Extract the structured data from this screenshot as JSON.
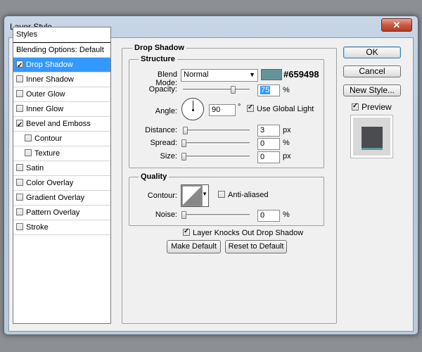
{
  "window": {
    "title": "Layer Style",
    "close_glyph": "✕"
  },
  "styles_panel": {
    "header": "Styles",
    "blending": "Blending Options: Default",
    "items": [
      {
        "label": "Drop Shadow",
        "checked": true,
        "selected": true,
        "indent": false
      },
      {
        "label": "Inner Shadow",
        "checked": false,
        "selected": false,
        "indent": false
      },
      {
        "label": "Outer Glow",
        "checked": false,
        "selected": false,
        "indent": false
      },
      {
        "label": "Inner Glow",
        "checked": false,
        "selected": false,
        "indent": false
      },
      {
        "label": "Bevel and Emboss",
        "checked": true,
        "selected": false,
        "indent": false
      },
      {
        "label": "Contour",
        "checked": false,
        "selected": false,
        "indent": true
      },
      {
        "label": "Texture",
        "checked": false,
        "selected": false,
        "indent": true
      },
      {
        "label": "Satin",
        "checked": false,
        "selected": false,
        "indent": false
      },
      {
        "label": "Color Overlay",
        "checked": false,
        "selected": false,
        "indent": false
      },
      {
        "label": "Gradient Overlay",
        "checked": false,
        "selected": false,
        "indent": false
      },
      {
        "label": "Pattern Overlay",
        "checked": false,
        "selected": false,
        "indent": false
      },
      {
        "label": "Stroke",
        "checked": false,
        "selected": false,
        "indent": false
      }
    ]
  },
  "drop_shadow": {
    "title": "Drop Shadow",
    "structure_title": "Structure",
    "blend_mode_label": "Blend Mode:",
    "blend_mode_value": "Normal",
    "color_hex": "#659498",
    "swatch_color": "#659498",
    "opacity_label": "Opacity:",
    "opacity_value": "75",
    "opacity_level": 0.75,
    "percent": "%",
    "angle_label": "Angle:",
    "angle_value": "90",
    "degree": "°",
    "use_global_light": "Use Global Light",
    "distance_label": "Distance:",
    "distance_value": "3",
    "spread_label": "Spread:",
    "spread_value": "0",
    "size_label": "Size:",
    "size_value": "0",
    "px": "px"
  },
  "quality": {
    "title": "Quality",
    "contour_label": "Contour:",
    "anti_aliased": "Anti-aliased",
    "noise_label": "Noise:",
    "noise_value": "0",
    "percent": "%"
  },
  "knockout_label": "Layer Knocks Out Drop Shadow",
  "make_default": "Make Default",
  "reset_default": "Reset to Default",
  "buttons": {
    "ok": "OK",
    "cancel": "Cancel",
    "new_style": "New Style...",
    "preview": "Preview"
  },
  "preview_colors": {
    "tile": "#4a4c50",
    "shadow": "#659498"
  }
}
